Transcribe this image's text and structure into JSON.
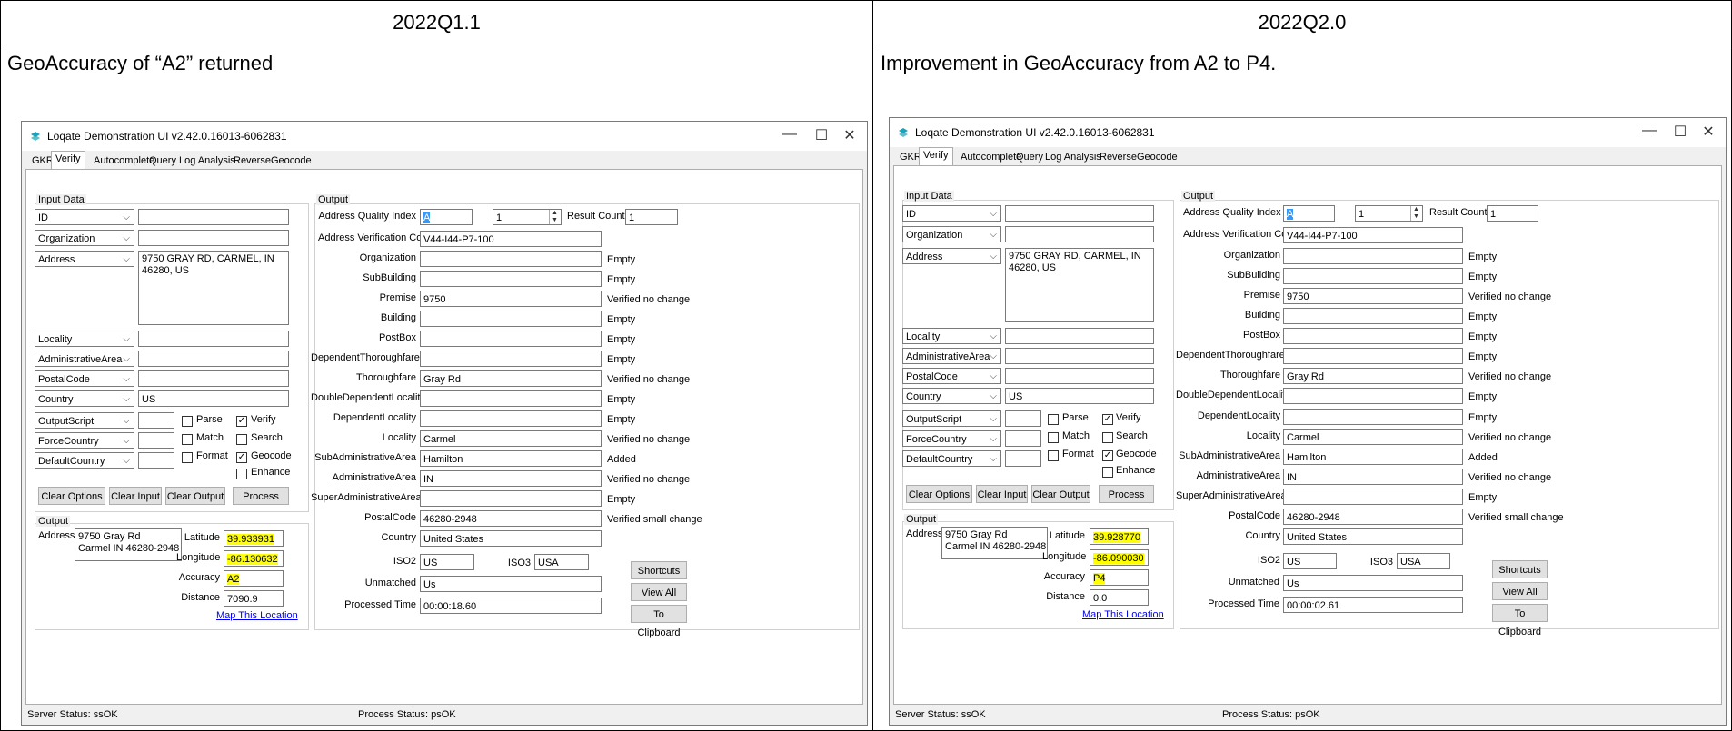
{
  "columns": [
    {
      "header": "2022Q1.1",
      "caption": "GeoAccuracy of “A2” returned"
    },
    {
      "header": "2022Q2.0",
      "caption": "Improvement in GeoAccuracy from A2 to P4."
    }
  ],
  "window": {
    "title": "Loqate Demonstration UI v2.42.0.16013-6062831",
    "minimize": "—",
    "maximize": "☐",
    "close": "✕",
    "tabs": [
      "GKR",
      "Verify",
      "Autocomplete",
      "Query",
      "Log Analysis",
      "ReverseGeocode"
    ],
    "active_tab": "Verify"
  },
  "input": {
    "group_label": "Input Data",
    "fields": [
      {
        "name": "ID",
        "value": ""
      },
      {
        "name": "Organization",
        "value": ""
      },
      {
        "name": "Address",
        "value": "9750 GRAY RD, CARMEL, IN 46280, US"
      },
      {
        "name": "Locality",
        "value": ""
      },
      {
        "name": "AdministrativeArea",
        "value": ""
      },
      {
        "name": "PostalCode",
        "value": ""
      },
      {
        "name": "Country",
        "value": "US"
      }
    ],
    "options": [
      {
        "name": "OutputScript"
      },
      {
        "name": "ForceCountry"
      },
      {
        "name": "DefaultCountry"
      }
    ],
    "checks": {
      "parse": "Parse",
      "match": "Match",
      "format": "Format",
      "verify": "Verify",
      "search": "Search",
      "geocode": "Geocode",
      "enhance": "Enhance"
    },
    "buttons": {
      "clear_options": "Clear Options",
      "clear_input": "Clear Input",
      "clear_output": "Clear Output",
      "process": "Process"
    }
  },
  "output_labels": {
    "group_label": "Output",
    "address": "Address",
    "latitude": "Latitude",
    "longitude": "Longitude",
    "accuracy": "Accuracy",
    "distance": "Distance",
    "map_link": "Map This Location",
    "aqi": "Address Quality Index",
    "result_count": "Result Count",
    "avc": "Address Verification Code",
    "iso2": "ISO2",
    "iso3": "ISO3",
    "unmatched": "Unmatched",
    "processed_time": "Processed Time",
    "shortcuts": "Shortcuts",
    "view_all": "View All",
    "to_clipboard": "To Clipboard",
    "server_status": "Server Status: ssOK",
    "process_status": "Process Status: psOK"
  },
  "left": {
    "output_address": "9750 Gray Rd\nCarmel IN 46280-2948",
    "latitude": "39.933931",
    "longitude": "-86.130632",
    "accuracy": "A2",
    "distance": "7090.9",
    "aqi": "A",
    "result_spin": "1",
    "result_count": "1",
    "avc": "V44-I44-P7-100",
    "fields": [
      {
        "label": "Organization",
        "value": "",
        "status": "Empty"
      },
      {
        "label": "SubBuilding",
        "value": "",
        "status": "Empty"
      },
      {
        "label": "Premise",
        "value": "9750",
        "status": "Verified no change"
      },
      {
        "label": "Building",
        "value": "",
        "status": "Empty"
      },
      {
        "label": "PostBox",
        "value": "",
        "status": "Empty"
      },
      {
        "label": "DependentThoroughfare",
        "value": "",
        "status": "Empty"
      },
      {
        "label": "Thoroughfare",
        "value": "Gray Rd",
        "status": "Verified no change"
      },
      {
        "label": "DoubleDependentLocality",
        "value": "",
        "status": "Empty"
      },
      {
        "label": "DependentLocality",
        "value": "",
        "status": "Empty"
      },
      {
        "label": "Locality",
        "value": "Carmel",
        "status": "Verified no change"
      },
      {
        "label": "SubAdministrativeArea",
        "value": "Hamilton",
        "status": "Added"
      },
      {
        "label": "AdministrativeArea",
        "value": "IN",
        "status": "Verified no change"
      },
      {
        "label": "SuperAdministrativeArea",
        "value": "",
        "status": "Empty"
      },
      {
        "label": "PostalCode",
        "value": "46280-2948",
        "status": "Verified small change"
      },
      {
        "label": "Country",
        "value": "United States",
        "status": ""
      }
    ],
    "iso2": "US",
    "iso3": "USA",
    "unmatched": "Us",
    "processed_time": "00:00:18.60"
  },
  "right": {
    "output_address": "9750 Gray Rd\nCarmel IN 46280-2948",
    "latitude": "39.928770",
    "longitude": "-86.090030",
    "accuracy": "P4",
    "distance": "0.0",
    "aqi": "A",
    "result_spin": "1",
    "result_count": "1",
    "avc": "V44-I44-P7-100",
    "fields": [
      {
        "label": "Organization",
        "value": "",
        "status": "Empty"
      },
      {
        "label": "SubBuilding",
        "value": "",
        "status": "Empty"
      },
      {
        "label": "Premise",
        "value": "9750",
        "status": "Verified no change"
      },
      {
        "label": "Building",
        "value": "",
        "status": "Empty"
      },
      {
        "label": "PostBox",
        "value": "",
        "status": "Empty"
      },
      {
        "label": "DependentThoroughfare",
        "value": "",
        "status": "Empty"
      },
      {
        "label": "Thoroughfare",
        "value": "Gray Rd",
        "status": "Verified no change"
      },
      {
        "label": "DoubleDependentLocality",
        "value": "",
        "status": "Empty"
      },
      {
        "label": "DependentLocality",
        "value": "",
        "status": "Empty"
      },
      {
        "label": "Locality",
        "value": "Carmel",
        "status": "Verified no change"
      },
      {
        "label": "SubAdministrativeArea",
        "value": "Hamilton",
        "status": "Added"
      },
      {
        "label": "AdministrativeArea",
        "value": "IN",
        "status": "Verified no change"
      },
      {
        "label": "SuperAdministrativeArea",
        "value": "",
        "status": "Empty"
      },
      {
        "label": "PostalCode",
        "value": "46280-2948",
        "status": "Verified small change"
      },
      {
        "label": "Country",
        "value": "United States",
        "status": ""
      }
    ],
    "iso2": "US",
    "iso3": "USA",
    "unmatched": "Us",
    "processed_time": "00:00:02.61"
  },
  "colors": {
    "highlight": "#ffff00",
    "selection": "#3399ff",
    "logo": "#1aa3b8",
    "link": "#0000ee"
  }
}
